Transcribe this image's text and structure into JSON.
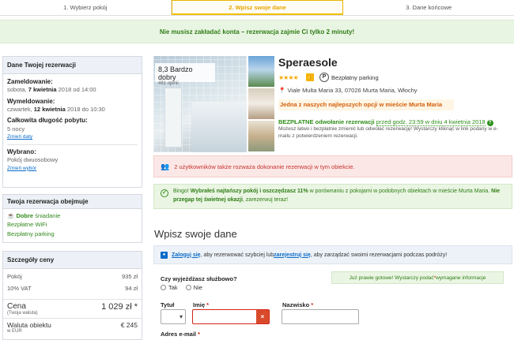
{
  "steps": [
    {
      "label": "1. Wybierz pokój"
    },
    {
      "label": "2. Wpisz swoje dane"
    },
    {
      "label": "3. Dane końcowe"
    }
  ],
  "banner": {
    "text": "Nie musisz zakładać konta – rezerwacja zajmie Ci tylko 2 minuty!"
  },
  "reservation": {
    "header": "Dane Twojej rezerwacji",
    "checkin_label": "Zameldowanie:",
    "checkin_day": "sobota, ",
    "checkin_date": "7 kwietnia",
    "checkin_rest": " 2018 od 14:00",
    "checkout_label": "Wymeldowanie:",
    "checkout_day": "czwartek, ",
    "checkout_date": "12 kwietnia",
    "checkout_rest": " 2018 do 10:30",
    "length_label": "Całkowita długość pobytu:",
    "length_value": "5 nocy",
    "change_dates": "Zmień daty",
    "chosen_label": "Wybrano:",
    "chosen_value": "Pokój dwuosobowy",
    "change_choice": "Zmień wybór"
  },
  "includes": {
    "header": "Twoja rezerwacja obejmuje",
    "items": [
      "Dobre",
      "śniadanie",
      "Bezpłatne WiFi",
      "Bezpłatny parking"
    ]
  },
  "price": {
    "header": "Szczegóły ceny",
    "rows": [
      {
        "label": "Pokój",
        "value": "935 zł"
      },
      {
        "label": "10% VAT",
        "value": "94 zł"
      }
    ],
    "total_label": "Cena",
    "total_sub": "(Twoja waluta)",
    "total_value": "1 029 zł *",
    "hotel_currency_label": "Waluta obiektu",
    "hotel_currency_sub": "w EUR",
    "hotel_currency_value": "€ 245"
  },
  "hotel": {
    "score": "8,3 Bardzo dobry",
    "reviews": "481 opinii",
    "name": "Speraesole",
    "stars": "★★★★",
    "like_badge": "👍",
    "parking_icon": "P",
    "parking": "Bezpłatny parking",
    "address": "Viale Multa Maria 33, 07026 Murta Maria, Włochy",
    "best_option": "Jedna z naszych najlepszych opcji w mieście Murta Maria",
    "free_cancel_bold": "BEZPŁATNE odwołanie rezerwacji",
    "free_cancel_until": "przed godz. 23:59 w dniu 4 kwietnia 2018",
    "cancel_note": "Możesz łatwo i bezpłatnie zmienić lub odwołać rezerwację! Wystarczy kliknąć w link podany w e-mailu z potwierdzeniem rezerwacji."
  },
  "alerts": {
    "red": "2 użytkowników także rozważa dokonanie rezerwacji w tym obiekcie.",
    "green_prefix": "Bingo! ",
    "green_bold": "Wybrałeś najtańszy pokój i oszczędzasz 11%",
    "green_mid": " w porównaniu z pokojami w podobnych obiektach w mieście Murta Maria. ",
    "green_bold2": "Nie przegap tej świetnej okazji",
    "green_end": ", zarezerwuj teraz!"
  },
  "form": {
    "title": "Wpisz swoje dane",
    "login_link": "Zaloguj się",
    "login_mid": ", aby rezerwować szybciej lub ",
    "register_link": "zarejestruj się",
    "login_end": ", aby zarządzać swoimi rezerwacjami podczas podróży!",
    "business_q": "Czy wyjeżdżasz służbowo?",
    "yes": "Tak",
    "no": "Nie",
    "ready_text": "Już prawie gotowe! Wystarczy podać ",
    "ready_end": " wymagane informacje",
    "title_label": "Tytuł",
    "first_name_label": "Imię",
    "last_name_label": "Nazwisko",
    "email_label": "Adres e-mail",
    "required_mark": "*",
    "error_mark": "×"
  },
  "colors": {
    "accent": "#0b6bc8",
    "active_step": "#e8a400",
    "success": "#2e7d15",
    "error": "#d3261a"
  }
}
